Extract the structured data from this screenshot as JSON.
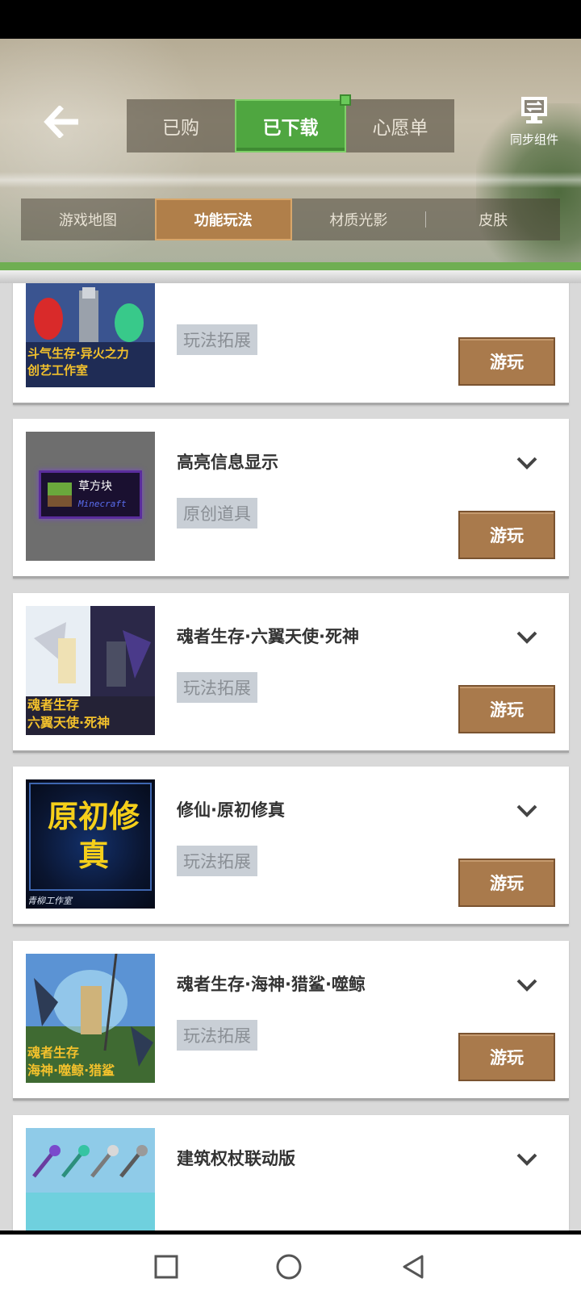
{
  "header": {
    "top_tabs": [
      {
        "label": "已购"
      },
      {
        "label": "已下载"
      },
      {
        "label": "心愿单"
      }
    ],
    "sync_label": "同步组件",
    "category_tabs": [
      {
        "label": "游戏地图"
      },
      {
        "label": "功能玩法"
      },
      {
        "label": "材质光影"
      },
      {
        "label": "皮肤"
      }
    ]
  },
  "items": [
    {
      "title": "",
      "tag": "玩法拓展",
      "play_label": "游玩",
      "thumb_text_1": "斗气生存·异火之力",
      "thumb_text_2": "创艺工作室"
    },
    {
      "title": "高亮信息显示",
      "tag": "原创道具",
      "play_label": "游玩",
      "thumb_text_1": "草方块",
      "thumb_text_2": "Minecraft"
    },
    {
      "title": "魂者生存·六翼天使·死神",
      "tag": "玩法拓展",
      "play_label": "游玩",
      "thumb_text_1": "魂者生存",
      "thumb_text_2": "六翼天使·死神"
    },
    {
      "title": "修仙·原初修真",
      "tag": "玩法拓展",
      "play_label": "游玩",
      "thumb_text_1": "原初修真",
      "thumb_text_2": "青柳工作室"
    },
    {
      "title": "魂者生存·海神·猎鲨·噬鲸",
      "tag": "玩法拓展",
      "play_label": "游玩",
      "thumb_text_1": "魂者生存",
      "thumb_text_2": "海神·噬鲸·猎鲨"
    },
    {
      "title": "建筑权杖联动版",
      "tag": "",
      "play_label": "",
      "thumb_text_1": "",
      "thumb_text_2": ""
    }
  ],
  "colors": {
    "active_tab": "#4fa640",
    "active_category": "#b07f4a",
    "play_button": "#a97a4c"
  }
}
